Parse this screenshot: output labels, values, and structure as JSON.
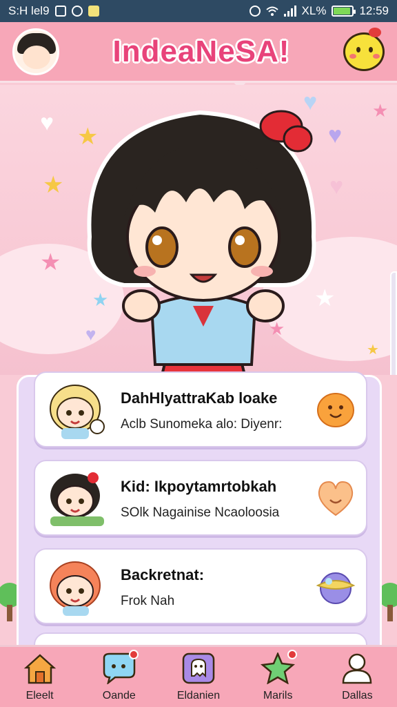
{
  "status_bar": {
    "left_text": "S:H lel9",
    "battery_text": "XL%",
    "time": "12:59",
    "battery_level": 0.9
  },
  "header": {
    "title": "IndeaNeSA!",
    "left_icon": "avatar-icon",
    "right_icon": "mascot-icon"
  },
  "list": {
    "items": [
      {
        "title": "DahHlyattraKab loake",
        "subtitle": "Aclb Sunomeka alo: Diyenr:",
        "badge_icon": "peach-face-icon"
      },
      {
        "title": "Kid: Ikpoytamrtobkah",
        "subtitle": "SOlk Nagainise Ncaoloosia",
        "badge_icon": "heart-icon"
      },
      {
        "title": "Backretnat:",
        "subtitle": "Frok Nah",
        "badge_icon": "planet-icon"
      }
    ]
  },
  "tabs": [
    {
      "label": "Eleelt",
      "icon": "home-icon"
    },
    {
      "label": "Oande",
      "icon": "chat-bubble-icon",
      "badge": true
    },
    {
      "label": "Eldanien",
      "icon": "ghost-icon"
    },
    {
      "label": "Marils",
      "icon": "star-icon",
      "badge": true
    },
    {
      "label": "Dallas",
      "icon": "profile-icon"
    }
  ],
  "colors": {
    "status_bar": "#2e4a63",
    "header": "#f7a7b8",
    "title": "#e8437a",
    "list_panel": "#e8d9f6",
    "tab_bar": "#f7a7b8"
  }
}
